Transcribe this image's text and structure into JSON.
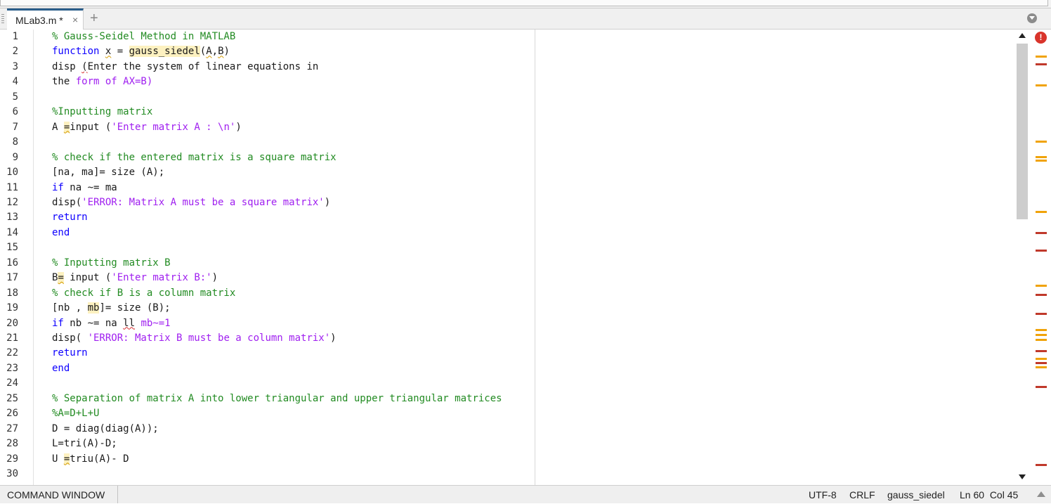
{
  "tab": {
    "label": "MLab3.m *",
    "close": "×",
    "add": "+"
  },
  "colors": {
    "comment": "#228b22",
    "keyword": "#0e00ff",
    "string": "#a020f0",
    "error_marker": "#c0392b",
    "warning_marker": "#f0a30a",
    "tab_accent": "#2a5d8a"
  },
  "line_numbers": [
    "1",
    "2",
    "3",
    "4",
    "5",
    "6",
    "7",
    "8",
    "9",
    "10",
    "11",
    "12",
    "13",
    "14",
    "15",
    "16",
    "17",
    "18",
    "19",
    "20",
    "21",
    "22",
    "23",
    "24",
    "25",
    "26",
    "27",
    "28",
    "29",
    "30"
  ],
  "code": {
    "l1": "% Gauss-Seidel Method in MATLAB",
    "l2": {
      "kw": "function",
      "a": " ",
      "x": "x",
      "b": " = ",
      "fn": "gauss_siedel",
      "c": "(",
      "A": "A",
      "d": ",",
      "B": "B",
      "e": ")"
    },
    "l3": {
      "a": "disp ",
      "p": "(",
      "b": "Enter the system of linear equations in"
    },
    "l4": {
      "a": "the ",
      "str": "form of AX=B)"
    },
    "l6": "%Inputting matrix",
    "l7": {
      "a": "A ",
      "eq": "=",
      "b": "input (",
      "str": "'Enter matrix A : \\n'",
      "c": ")"
    },
    "l9": "% check if the entered matrix is a square matrix",
    "l10": "[na, ma]= size (A);",
    "l11": {
      "kw": "if",
      "a": " na ~= ma"
    },
    "l12": {
      "a": "disp(",
      "str": "'ERROR: Matrix A must be a square matrix'",
      "b": ")"
    },
    "l13": "return",
    "l14": "end",
    "l16": "% Inputting matrix B",
    "l17": {
      "a": "B",
      "eq": "=",
      "b": " input (",
      "str": "'Enter matrix B:'",
      "c": ")"
    },
    "l18": "% check if B is a column matrix",
    "l19": {
      "a": "[nb , ",
      "mb": "mb",
      "b": "]= size (B);"
    },
    "l20": {
      "kw": "if",
      "a": " nb ~= na ",
      "ll": "ll",
      "b": " ",
      "str": "mb~=1"
    },
    "l21": {
      "a": "disp( ",
      "str": "'ERROR: Matrix B must be a column matrix'",
      "b": ")"
    },
    "l22": "return",
    "l23": "end",
    "l25": "% Separation of matrix A into lower triangular and upper triangular matrices",
    "l26": "%A=D+L+U",
    "l27": "D = diag(diag(A));",
    "l28": "L=tri(A)-D;",
    "l29": {
      "a": "U ",
      "eq": "=",
      "b": "triu(A)- D"
    }
  },
  "markers": {
    "error_icon": "!"
  },
  "status": {
    "command_window": "COMMAND WINDOW",
    "encoding": "UTF-8",
    "line_ending": "CRLF",
    "function": "gauss_siedel",
    "position": "Ln 60  Col 45"
  }
}
